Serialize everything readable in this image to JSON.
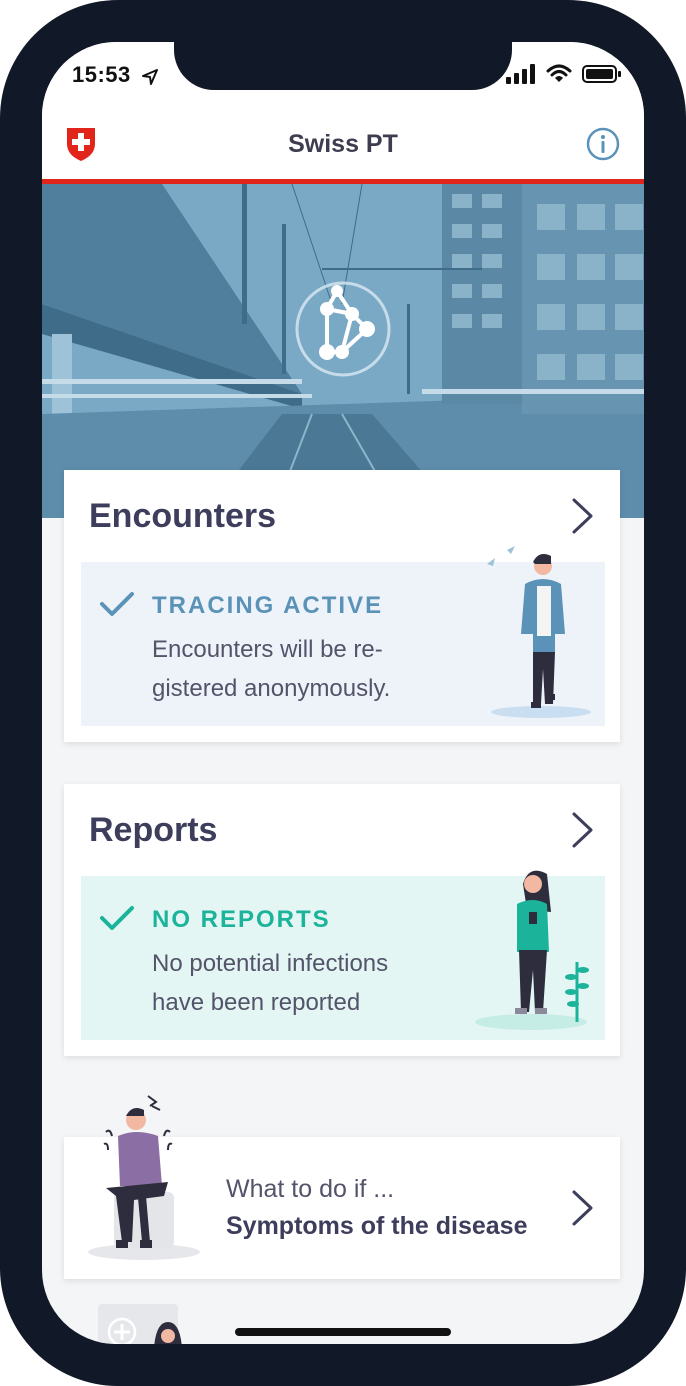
{
  "status": {
    "time": "15:53"
  },
  "header": {
    "title": "Swiss PT"
  },
  "encounters": {
    "title": "Encounters",
    "status_label": "TRACING ACTIVE",
    "status_text": "Encounters will be re-gistered anonymously."
  },
  "reports": {
    "title": "Reports",
    "status_label": "NO REPORTS",
    "status_text": "No potential infections have been reported"
  },
  "symptoms": {
    "subtitle": "What to do if ...",
    "title": "Symptoms of the disease"
  },
  "colors": {
    "accent_blue": "#5b93b8",
    "accent_green": "#1cb39b",
    "red": "#e1251b",
    "text_dark": "#3d3d5c"
  }
}
